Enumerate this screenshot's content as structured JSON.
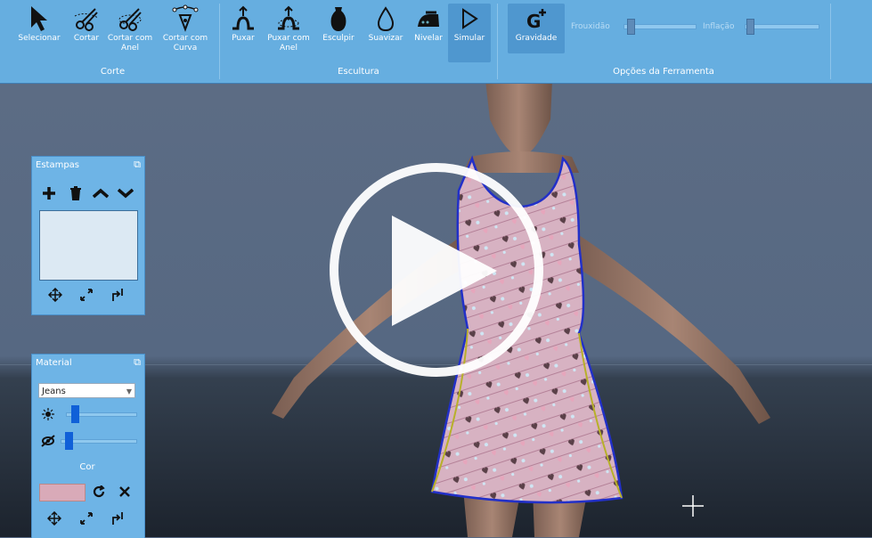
{
  "ribbon": {
    "groups": {
      "corte": "Corte",
      "escultura": "Escultura",
      "opcoes": "Opções da Ferramenta"
    },
    "tools": {
      "selecionar": "Selecionar",
      "cortar": "Cortar",
      "cortar_anel": "Cortar com Anel",
      "cortar_curva": "Cortar com Curva",
      "puxar": "Puxar",
      "puxar_anel": "Puxar com Anel",
      "esculpir": "Esculpir",
      "suavizar": "Suavizar",
      "nivelar": "Nivelar",
      "simular": "Simular",
      "gravidade": "Gravidade"
    },
    "options": {
      "frouxidao_label": "Frouxidão",
      "frouxidao_value": 0.05,
      "inflacao_label": "Inflação",
      "inflacao_value": 0.02
    }
  },
  "stamps_panel": {
    "title": "Estampas",
    "pin_icon": "pin-icon"
  },
  "material_panel": {
    "title": "Material",
    "selected_material": "Jeans",
    "brightness_value": 0.37,
    "visibility_value": 0.28,
    "color_label": "Cor",
    "color_swatch": "#d9aab8"
  },
  "colors": {
    "ribbon": "#66aee0",
    "panel": "#6eb4e6",
    "viewport_bg": "#586a84"
  },
  "overlay": {
    "play_icon": "play-icon"
  }
}
